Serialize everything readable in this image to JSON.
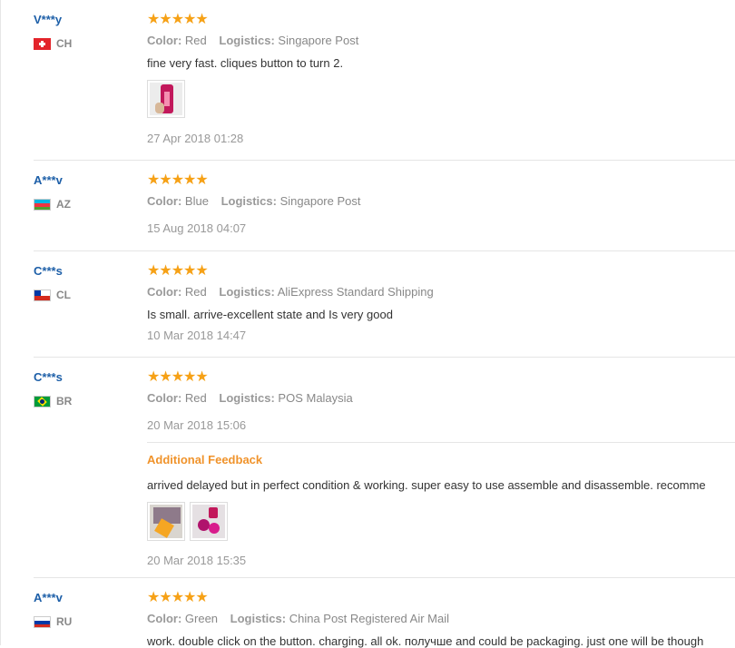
{
  "labels": {
    "color": "Color:",
    "logistics": "Logistics:",
    "additional_feedback": "Additional Feedback"
  },
  "accent_colors": {
    "username": "#1d5fa8",
    "stars": "#f6a116",
    "additional_feedback": "#f0932b"
  },
  "reviews": [
    {
      "user": "V***y",
      "country": "CH",
      "rating": 5,
      "stars": "★★★★★",
      "color": "Red",
      "logistics": "Singapore Post",
      "text": "fine very fast. cliques button to turn 2.",
      "photos": 1,
      "date": "27 Apr 2018 01:28"
    },
    {
      "user": "A***v",
      "country": "AZ",
      "rating": 5,
      "stars": "★★★★★",
      "color": "Blue",
      "logistics": "Singapore Post",
      "date": "15 Aug 2018 04:07"
    },
    {
      "user": "C***s",
      "country": "CL",
      "rating": 5,
      "stars": "★★★★★",
      "color": "Red",
      "logistics": "AliExpress Standard Shipping",
      "text": "Is small. arrive-excellent state and Is very good",
      "date": "10 Mar 2018 14:47"
    },
    {
      "user": "C***s",
      "country": "BR",
      "rating": 5,
      "stars": "★★★★★",
      "color": "Red",
      "logistics": "POS Malaysia",
      "date": "20 Mar 2018 15:06",
      "additional_feedback": {
        "text": "arrived delayed but in perfect condition & working. super easy to use assemble and disassemble. recomme",
        "photos": 2,
        "date": "20 Mar 2018 15:35"
      }
    },
    {
      "user": "A***v",
      "country": "RU",
      "rating": 5,
      "stars": "★★★★★",
      "color": "Green",
      "logistics": "China Post Registered Air Mail",
      "text": "work. double click on the button. charging. all ok. получше and could be packaging. just one will be though"
    }
  ]
}
